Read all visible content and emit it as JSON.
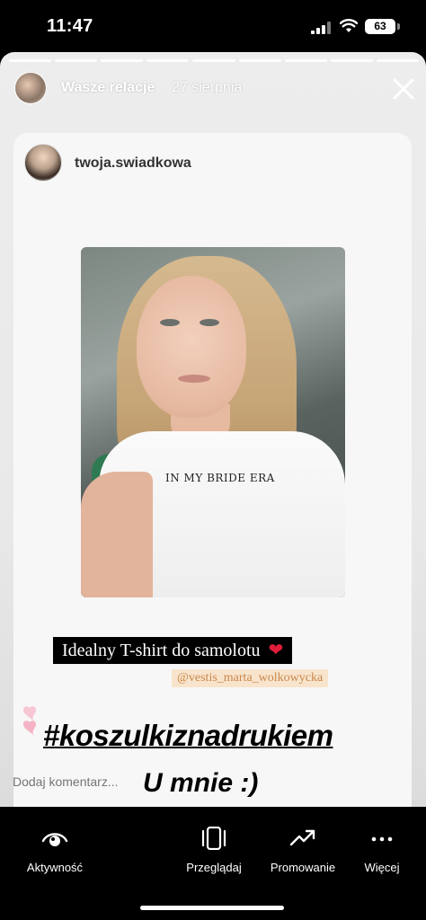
{
  "status_bar": {
    "time": "11:47",
    "battery": "63"
  },
  "story": {
    "user": "Wasze relacje",
    "date": "27 sierpnia",
    "progress_segments": 9,
    "active_segment": 8
  },
  "card": {
    "user": "twoja.swiadkowa",
    "photo_shirt_text": "IN MY BRIDE ERA",
    "caption": "Idealny T-shirt do samolotu",
    "caption_emoji": "❤",
    "mention": "@vestis_marta_wolkowycka",
    "hashtag": "#koszulkiznadrukiem",
    "subtext": "U mnie :)"
  },
  "comment": {
    "placeholder": "Dodaj komentarz..."
  },
  "bottom_nav": {
    "activity": "Aktywność",
    "browse": "Przeglądaj",
    "promote": "Promowanie",
    "more": "Więcej"
  },
  "colors": {
    "heart": "#e01e3c",
    "mention_bg": "#f8e4cc",
    "mention_text": "#c9874b"
  }
}
